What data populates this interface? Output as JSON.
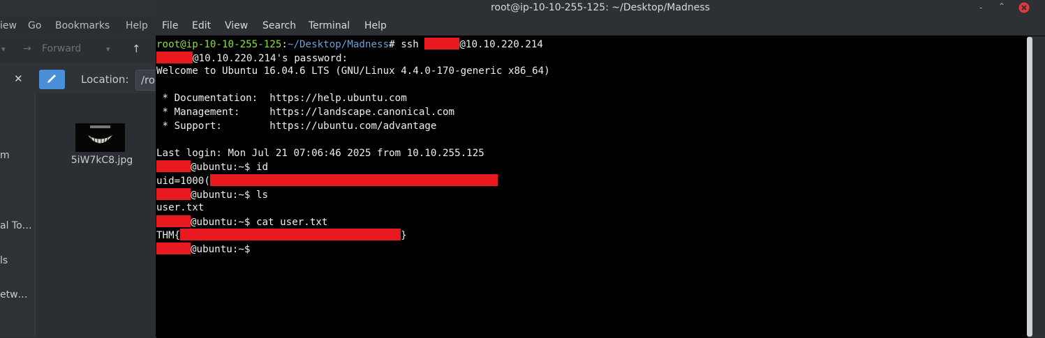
{
  "file_manager": {
    "menu": [
      "iew",
      "Go",
      "Bookmarks",
      "Help"
    ],
    "toolbar": {
      "back_arrow": "▾",
      "forward_label": "Forward",
      "up_icon": "up-arrow-icon"
    },
    "location_label": "Location:",
    "location_value": "/ro",
    "sidebar": [
      "m",
      "al To…",
      "ls",
      "etw…"
    ],
    "file": {
      "name": "5iW7kC8.jpg"
    }
  },
  "terminal": {
    "title": "root@ip-10-10-255-125: ~/Desktop/Madness",
    "menu": [
      "File",
      "Edit",
      "View",
      "Search",
      "Terminal",
      "Help"
    ],
    "lines": {
      "l1_user": "root@ip-10-10-255-125",
      "l1_sep": ":",
      "l1_path": "~/Desktop/Madness",
      "l1_cmd": "# ssh ",
      "l1_host": "@10.10.220.214",
      "l2": "@10.10.220.214's password:",
      "l3": "Welcome to Ubuntu 16.04.6 LTS (GNU/Linux 4.4.0-170-generic x86_64)",
      "l5": " * Documentation:  https://help.ubuntu.com",
      "l6": " * Management:     https://landscape.canonical.com",
      "l7": " * Support:        https://ubuntu.com/advantage",
      "l9": "Last login: Mon Jul 21 07:06:46 2025 from 10.10.255.125",
      "l10": "@ubuntu:~$ id",
      "l11": "uid=1000(",
      "l12": "@ubuntu:~$ ls",
      "l13": "user.txt",
      "l14": "@ubuntu:~$ cat user.txt",
      "l15a": "THM{",
      "l15b": "}",
      "l16": "@ubuntu:~$"
    }
  },
  "colors": {
    "redaction": "#e8191f",
    "prompt_green": "#8ae234",
    "path_blue": "#729fcf",
    "close_button": "#e63939"
  }
}
